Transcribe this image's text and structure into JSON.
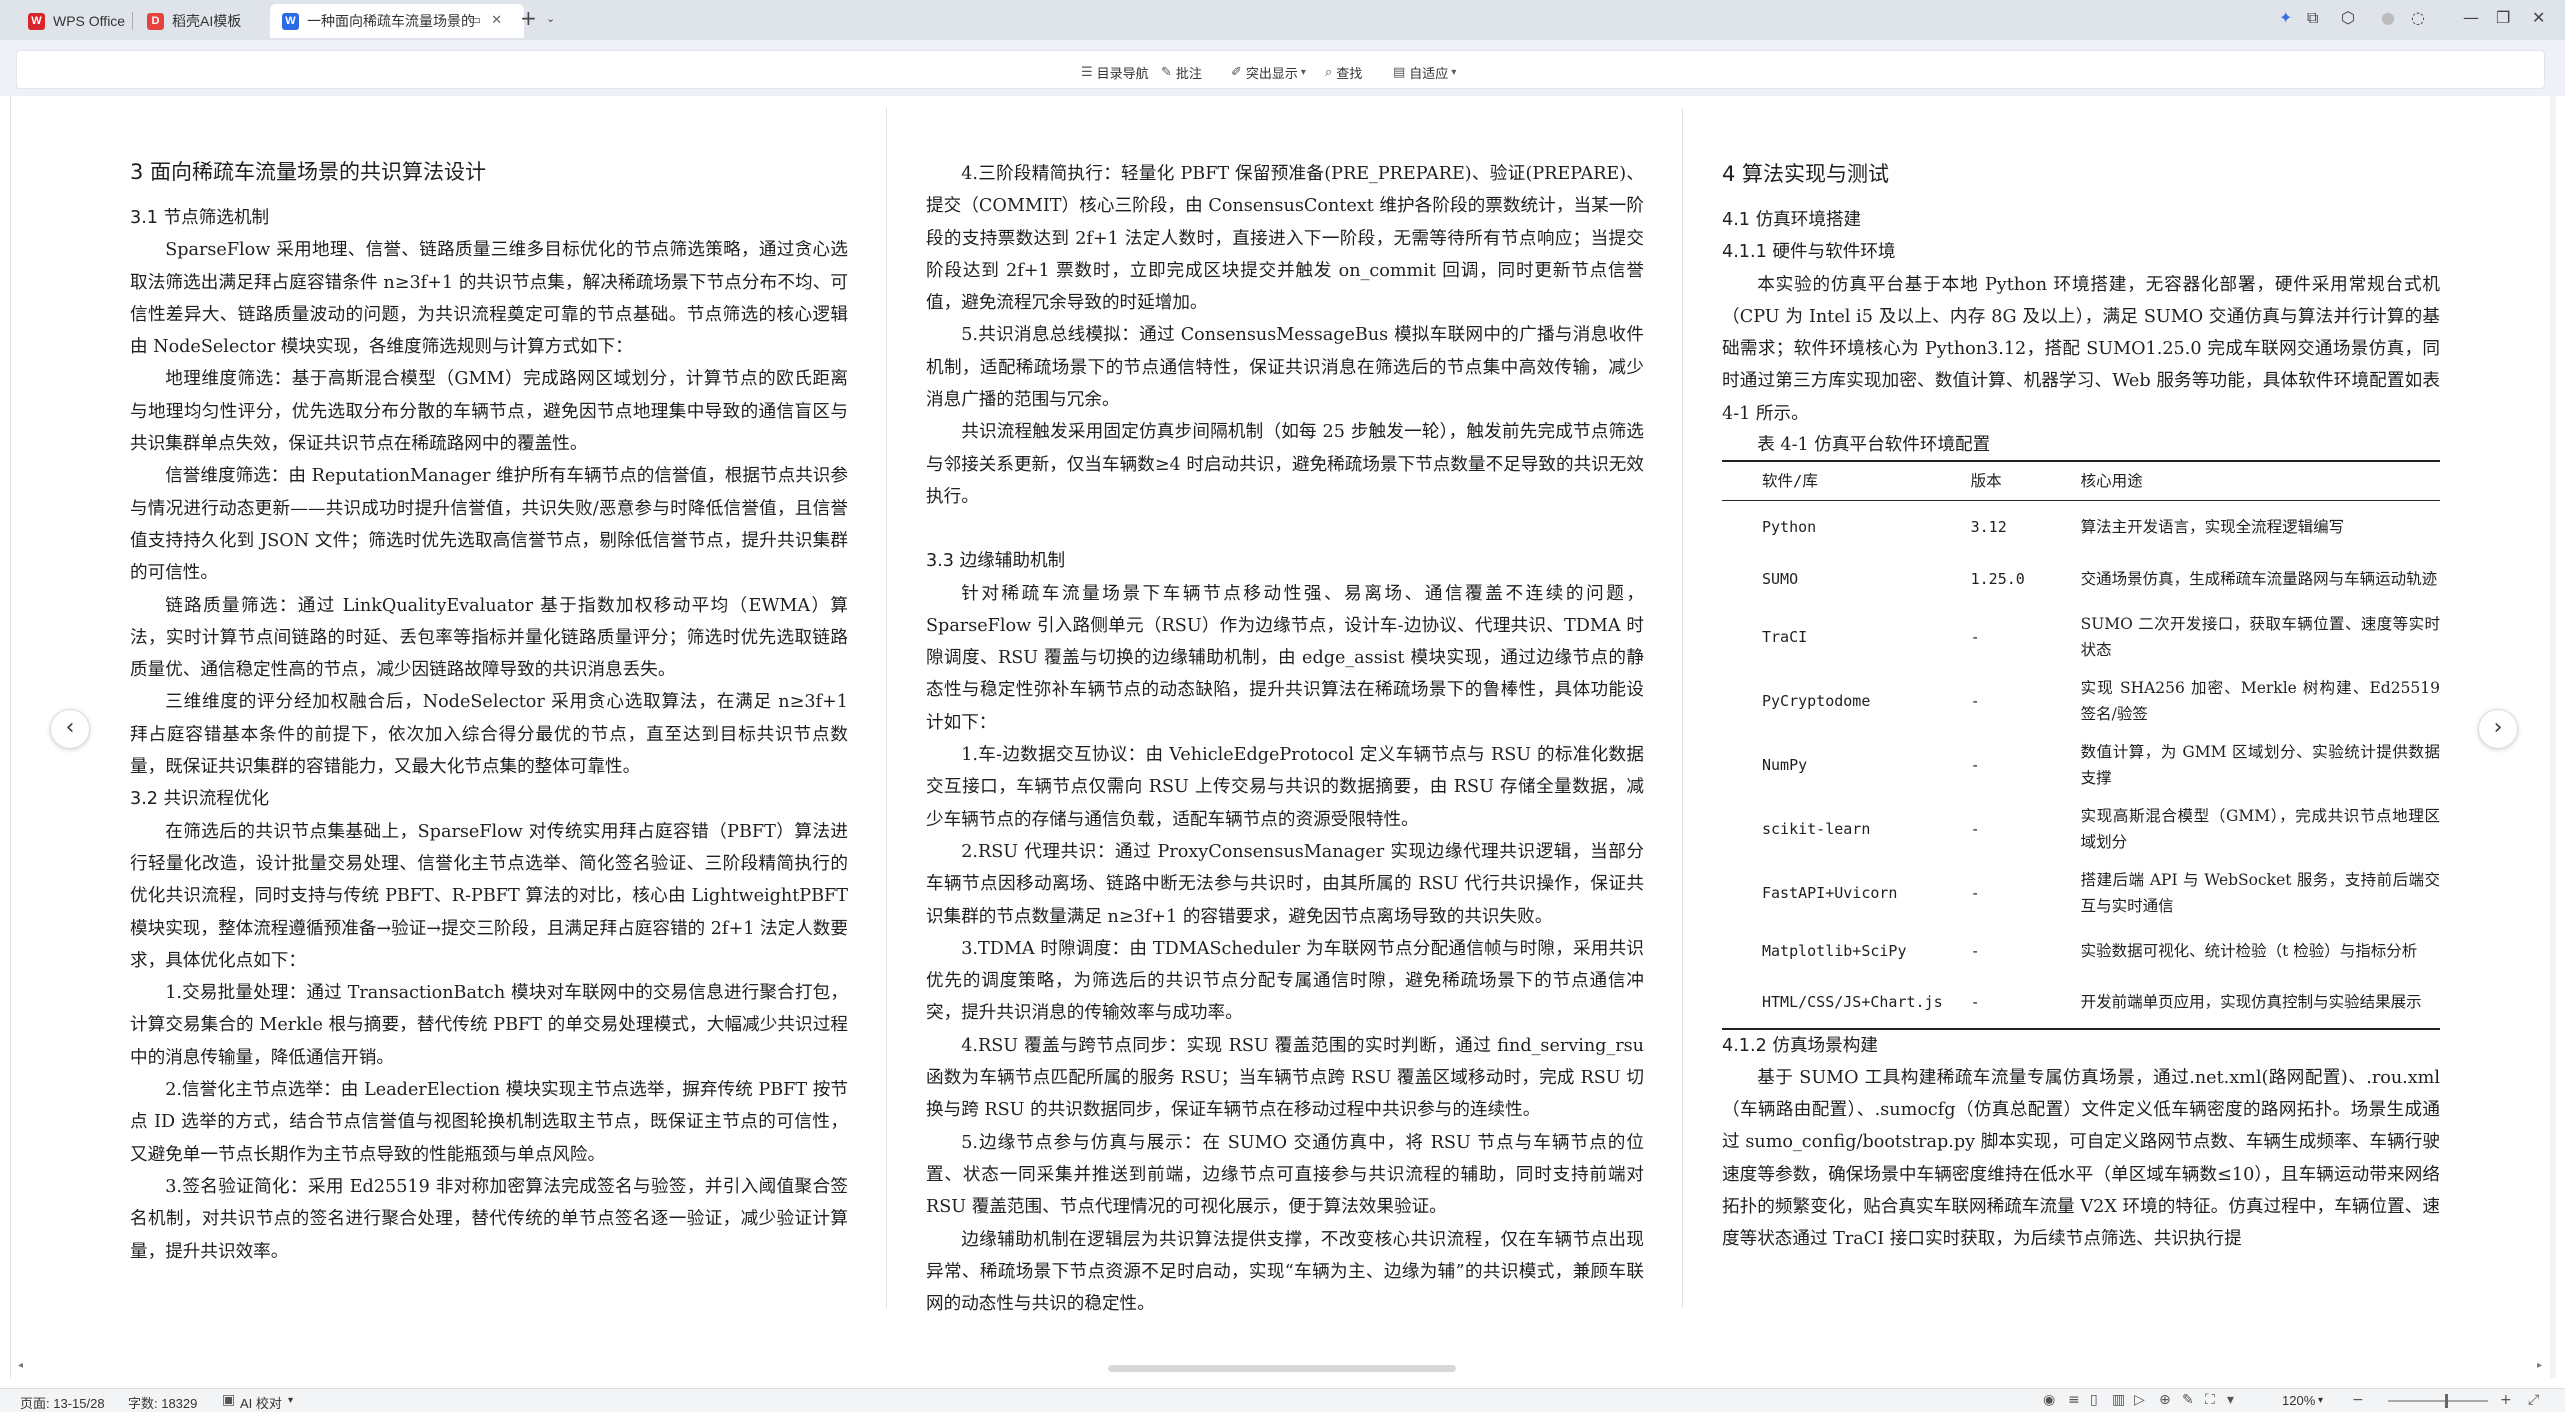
{
  "tabs": {
    "wps": "WPS Office",
    "template": "稻壳AI模板",
    "document": "一种面向稀疏车流量场景的"
  },
  "toolbar": {
    "toc": "目录导航",
    "comment": "批注",
    "highlight": "突出显示",
    "find": "查找",
    "fit": "自适应"
  },
  "page1": {
    "h_chapter": "3 面向稀疏车流量场景的共识算法设计",
    "h_31": "3.1 节点筛选机制",
    "p1": "SparseFlow 采用地理、信誉、链路质量三维多目标优化的节点筛选策略，通过贪心选取法筛选出满足拜占庭容错条件 n≥3f+1 的共识节点集，解决稀疏场景下节点分布不均、可信性差异大、链路质量波动的问题，为共识流程奠定可靠的节点基础。节点筛选的核心逻辑由 NodeSelector 模块实现，各维度筛选规则与计算方式如下：",
    "p2": "地理维度筛选：基于高斯混合模型（GMM）完成路网区域划分，计算节点的欧氏距离与地理均匀性评分，优先选取分布分散的车辆节点，避免因节点地理集中导致的通信盲区与共识集群单点失效，保证共识节点在稀疏路网中的覆盖性。",
    "p3": "信誉维度筛选：由 ReputationManager 维护所有车辆节点的信誉值，根据节点共识参与情况进行动态更新——共识成功时提升信誉值，共识失败/恶意参与时降低信誉值，且信誉值支持持久化到 JSON 文件；筛选时优先选取高信誉节点，剔除低信誉节点，提升共识集群的可信性。",
    "p4": "链路质量筛选：通过 LinkQualityEvaluator 基于指数加权移动平均（EWMA）算法，实时计算节点间链路的时延、丢包率等指标并量化链路质量评分；筛选时优先选取链路质量优、通信稳定性高的节点，减少因链路故障导致的共识消息丢失。",
    "p5": "三维维度的评分经加权融合后，NodeSelector 采用贪心选取算法，在满足 n≥3f+1 拜占庭容错基本条件的前提下，依次加入综合得分最优的节点，直至达到目标共识节点数量，既保证共识集群的容错能力，又最大化节点集的整体可靠性。",
    "h_32": "3.2 共识流程优化",
    "p6": "在筛选后的共识节点集基础上，SparseFlow 对传统实用拜占庭容错（PBFT）算法进行轻量化改造，设计批量交易处理、信誉化主节点选举、简化签名验证、三阶段精简执行的优化共识流程，同时支持与传统 PBFT、R-PBFT 算法的对比，核心由 LightweightPBFT 模块实现，整体流程遵循预准备→验证→提交三阶段，且满足拜占庭容错的 2f+1 法定人数要求，具体优化点如下：",
    "p7": "1.交易批量处理：通过 TransactionBatch 模块对车联网中的交易信息进行聚合打包，计算交易集合的 Merkle 根与摘要，替代传统 PBFT 的单交易处理模式，大幅减少共识过程中的消息传输量，降低通信开销。",
    "p8": "2.信誉化主节点选举：由 LeaderElection 模块实现主节点选举，摒弃传统 PBFT 按节点 ID 选举的方式，结合节点信誉值与视图轮换机制选取主节点，既保证主节点的可信性，又避免单一节点长期作为主节点导致的性能瓶颈与单点风险。",
    "p9": "3.签名验证简化：采用 Ed25519 非对称加密算法完成签名与验签，并引入阈值聚合签名机制，对共识节点的签名进行聚合处理，替代传统的单节点签名逐一验证，减少验证计算量，提升共识效率。"
  },
  "page2": {
    "p1": "4.三阶段精简执行：轻量化 PBFT 保留预准备(PRE_PREPARE)、验证(PREPARE)、提交（COMMIT）核心三阶段，由 ConsensusContext 维护各阶段的票数统计，当某一阶段的支持票数达到 2f+1 法定人数时，直接进入下一阶段，无需等待所有节点响应；当提交阶段达到 2f+1 票数时，立即完成区块提交并触发 on_commit 回调，同时更新节点信誉值，避免流程冗余导致的时延增加。",
    "p2": "5.共识消息总线模拟：通过 ConsensusMessageBus 模拟车联网中的广播与消息收件机制，适配稀疏场景下的节点通信特性，保证共识消息在筛选后的节点集中高效传输，减少消息广播的范围与冗余。",
    "p3": "共识流程触发采用固定仿真步间隔机制（如每 25 步触发一轮），触发前先完成节点筛选与邻接关系更新，仅当车辆数≥4 时启动共识，避免稀疏场景下节点数量不足导致的共识无效执行。",
    "h_33": "3.3 边缘辅助机制",
    "p4": "针对稀疏车流量场景下车辆节点移动性强、易离场、通信覆盖不连续的问题，SparseFlow 引入路侧单元（RSU）作为边缘节点，设计车-边协议、代理共识、TDMA 时隙调度、RSU 覆盖与切换的边缘辅助机制，由 edge_assist 模块实现，通过边缘节点的静态性与稳定性弥补车辆节点的动态缺陷，提升共识算法在稀疏场景下的鲁棒性，具体功能设计如下：",
    "p5": "1.车-边数据交互协议：由 VehicleEdgeProtocol 定义车辆节点与 RSU 的标准化数据交互接口，车辆节点仅需向 RSU 上传交易与共识的数据摘要，由 RSU 存储全量数据，减少车辆节点的存储与通信负载，适配车辆节点的资源受限特性。",
    "p6": "2.RSU 代理共识：通过 ProxyConsensusManager 实现边缘代理共识逻辑，当部分车辆节点因移动离场、链路中断无法参与共识时，由其所属的 RSU 代行共识操作，保证共识集群的节点数量满足 n≥3f+1 的容错要求，避免因节点离场导致的共识失败。",
    "p7": "3.TDMA 时隙调度：由 TDMAScheduler 为车联网节点分配通信帧与时隙，采用共识优先的调度策略，为筛选后的共识节点分配专属通信时隙，避免稀疏场景下的节点通信冲突，提升共识消息的传输效率与成功率。",
    "p8": "4.RSU 覆盖与跨节点同步：实现 RSU 覆盖范围的实时判断，通过 find_serving_rsu 函数为车辆节点匹配所属的服务 RSU；当车辆节点跨 RSU 覆盖区域移动时，完成 RSU 切换与跨 RSU 的共识数据同步，保证车辆节点在移动过程中共识参与的连续性。",
    "p9": "5.边缘节点参与仿真与展示：在 SUMO 交通仿真中，将 RSU 节点与车辆节点的位置、状态一同采集并推送到前端，边缘节点可直接参与共识流程的辅助，同时支持前端对 RSU 覆盖范围、节点代理情况的可视化展示，便于算法效果验证。",
    "p10": "边缘辅助机制在逻辑层为共识算法提供支撑，不改变核心共识流程，仅在车辆节点出现异常、稀疏场景下节点资源不足时启动，实现“车辆为主、边缘为辅”的共识模式，兼顾车联网的动态性与共识的稳定性。"
  },
  "page3": {
    "h_chapter": "4 算法实现与测试",
    "h_41": "4.1 仿真环境搭建",
    "h_411": "4.1.1 硬件与软件环境",
    "p1": "本实验的仿真平台基于本地 Python 环境搭建，无容器化部署，硬件采用常规台式机（CPU 为 Intel i5 及以上、内存 8G 及以上），满足 SUMO 交通仿真与算法并行计算的基础需求；软件环境核心为 Python3.12，搭配 SUMO1.25.0 完成车联网交通场景仿真，同时通过第三方库实现加密、数值计算、机器学习、Web 服务等功能，具体软件环境配置如表 4-1 所示。",
    "table_caption": "表 4-1 仿真平台软件环境配置",
    "table_headers": [
      "软件/库",
      "版本",
      "核心用途"
    ],
    "table_rows": [
      [
        "Python",
        "3.12",
        "算法主开发语言，实现全流程逻辑编写"
      ],
      [
        "SUMO",
        "1.25.0",
        "交通场景仿真，生成稀疏车流量路网与车辆运动轨迹"
      ],
      [
        "TraCI",
        "-",
        "SUMO 二次开发接口，获取车辆位置、速度等实时状态"
      ],
      [
        "PyCryptodome",
        "-",
        "实现 SHA256 加密、Merkle 树构建、Ed25519 签名/验签"
      ],
      [
        "NumPy",
        "-",
        "数值计算，为 GMM 区域划分、实验统计提供数据支撑"
      ],
      [
        "scikit-learn",
        "-",
        "实现高斯混合模型（GMM），完成共识节点地理区域划分"
      ],
      [
        "FastAPI+Uvicorn",
        "-",
        "搭建后端 API 与 WebSocket 服务，支持前后端交互与实时通信"
      ],
      [
        "Matplotlib+SciPy",
        "-",
        "实验数据可视化、统计检验（t 检验）与指标分析"
      ],
      [
        "HTML/CSS/JS+Chart.js",
        "-",
        "开发前端单页应用，实现仿真控制与实验结果展示"
      ]
    ],
    "h_412": "4.1.2 仿真场景构建",
    "p2": "基于 SUMO 工具构建稀疏车流量专属仿真场景，通过.net.xml(路网配置)、.rou.xml（车辆路由配置）、.sumocfg（仿真总配置）文件定义低车辆密度的路网拓扑。场景生成通过 sumo_config/bootstrap.py 脚本实现，可自定义路网节点数、车辆生成频率、车辆行驶速度等参数，确保场景中车辆密度维持在低水平（单区域车辆数≤10），且车辆运动带来网络拓扑的频繁变化，贴合真实车联网稀疏车流量 V2X 环境的特征。仿真过程中，车辆位置、速度等状态通过 TraCI 接口实时获取，为后续节点筛选、共识执行提"
  },
  "status": {
    "page": "页面: 13-15/28",
    "words": "字数: 18329",
    "proof": "AI 校对",
    "zoom": "120%"
  },
  "colors": {
    "titlebar": "#dfe3ea",
    "toolbar": "#eef1f5",
    "wps_red": "#d8262c",
    "docer_red": "#e8423f",
    "writer_blue": "#2b6be4"
  }
}
